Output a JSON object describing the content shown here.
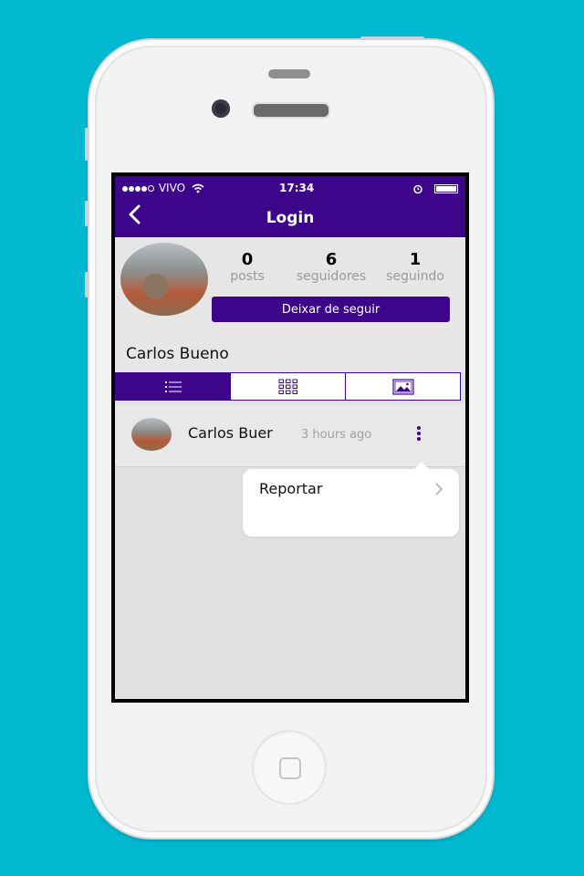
{
  "status_bar": {
    "carrier": "VIVO",
    "time": "17:34"
  },
  "nav": {
    "title": "Login"
  },
  "profile": {
    "posts_count": "0",
    "posts_label": "posts",
    "followers_count": "6",
    "followers_label": "seguidores",
    "following_count": "1",
    "following_label": "seguindo",
    "follow_button": "Deixar de seguir",
    "name": "Carlos Bueno"
  },
  "tabs": [
    {
      "name": "list-view",
      "active": true
    },
    {
      "name": "grid-view",
      "active": false
    },
    {
      "name": "photo-view",
      "active": false
    }
  ],
  "post": {
    "author": "Carlos Buer",
    "time": "3 hours ago"
  },
  "menu": {
    "report_label": "Reportar"
  },
  "colors": {
    "primary": "#3d0589",
    "background": "#00b9d1"
  }
}
